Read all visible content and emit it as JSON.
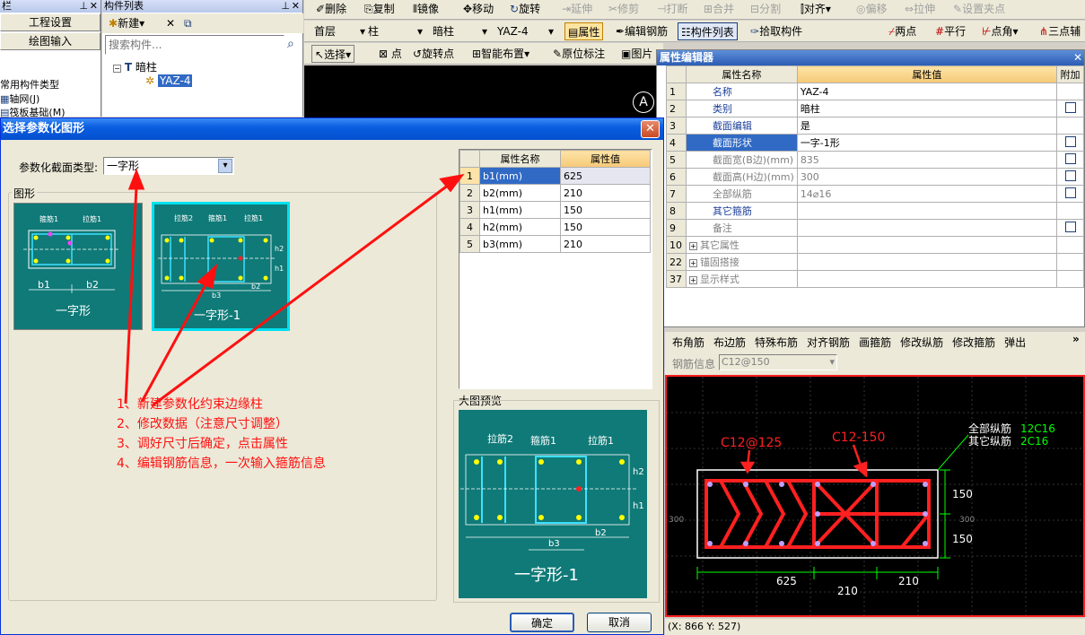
{
  "left_panel": {
    "title": "栏",
    "btn_project": "工程设置",
    "btn_drawing": "绘图输入",
    "tree_root": "常用构件类型",
    "tree_items": [
      "轴网(J)",
      "筏板基础(M)"
    ]
  },
  "comp_list": {
    "title": "构件列表",
    "new_label": "新建",
    "search_placeholder": "搜索构件...",
    "root": "暗柱",
    "child": "YAZ-4"
  },
  "toolbar1": {
    "delete": "删除",
    "copy": "复制",
    "mirror": "镜像",
    "move": "移动",
    "rotate": "旋转",
    "extend": "延伸",
    "trim": "修剪",
    "break": "打断",
    "merge": "合并",
    "split": "分割",
    "align": "对齐",
    "offset": "偏移",
    "stretch": "拉伸",
    "set_point": "设置夹点"
  },
  "toolbar2": {
    "floor": "首层",
    "type": "柱",
    "subtype": "暗柱",
    "comp": "YAZ-4",
    "props": "属性",
    "edit_rebar": "编辑钢筋",
    "comp_list": "构件列表",
    "pick": "拾取构件",
    "two_pt": "两点",
    "parallel": "平行",
    "pt_angle": "点角",
    "three_pt": "三点辅"
  },
  "toolbar3": {
    "select": "选择",
    "point": "点",
    "rotate_pt": "旋转点",
    "smart": "智能布置",
    "origin": "原位标注",
    "img": "图片"
  },
  "axis_label": "A",
  "prop_editor": {
    "title": "属性编辑器",
    "col_name": "属性名称",
    "col_value": "属性值",
    "col_extra": "附加",
    "rows": [
      {
        "n": "1",
        "name": "名称",
        "value": "YAZ-4",
        "blue": true,
        "chk": false
      },
      {
        "n": "2",
        "name": "类别",
        "value": "暗柱",
        "blue": true,
        "chk": true
      },
      {
        "n": "3",
        "name": "截面编辑",
        "value": "是",
        "blue": true,
        "chk": false
      },
      {
        "n": "4",
        "name": "截面形状",
        "value": "一字-1形",
        "blue": true,
        "chk": true,
        "sel": true
      },
      {
        "n": "5",
        "name": "截面宽(B边)(mm)",
        "value": "835",
        "blue": false,
        "chk": true
      },
      {
        "n": "6",
        "name": "截面高(H边)(mm)",
        "value": "300",
        "blue": false,
        "chk": true
      },
      {
        "n": "7",
        "name": "全部纵筋",
        "value": "14⌀16",
        "blue": false,
        "chk": true
      },
      {
        "n": "8",
        "name": "其它箍筋",
        "value": "",
        "blue": true,
        "chk": false
      },
      {
        "n": "9",
        "name": "备注",
        "value": "",
        "blue": false,
        "chk": true
      },
      {
        "n": "10",
        "name": "其它属性",
        "value": "",
        "blue": false,
        "chk": false,
        "plus": true
      },
      {
        "n": "22",
        "name": "锚固搭接",
        "value": "",
        "blue": false,
        "chk": false,
        "plus": true
      },
      {
        "n": "37",
        "name": "显示样式",
        "value": "",
        "blue": false,
        "chk": false,
        "plus": true
      }
    ]
  },
  "rebar_toolbar": {
    "items": [
      "布角筋",
      "布边筋",
      "特殊布筋",
      "对齐钢筋",
      "画箍筋",
      "修改纵筋",
      "修改箍筋",
      "弹出"
    ],
    "info_label": "钢筋信息",
    "info_value": "C12@150"
  },
  "section_view": {
    "label_c12_125": "C12@125",
    "label_c12_150": "C12-150",
    "all_long": "全部纵筋",
    "all_long_val": "12C16",
    "other_long": "其它纵筋",
    "other_long_val": "2C16",
    "dim_h1": "150",
    "dim_h2": "150",
    "dim_b1": "625",
    "dim_b2": "210",
    "dim_b3": "210",
    "left_dim": "300",
    "right_dim": "300"
  },
  "status_bar": "(X: 866 Y: 527)",
  "dialog": {
    "title": "选择参数化图形",
    "type_label": "参数化截面类型:",
    "type_value": "一字形",
    "group_shape": "图形",
    "shape1_name": "一字形",
    "shape2_name": "一字形-1",
    "labels": {
      "gujin": "箍筋1",
      "lajin": "拉筋1",
      "lajin2": "拉筋2",
      "b1": "b1",
      "b2": "b2",
      "b3": "b3",
      "h1": "h1",
      "h2": "h2"
    },
    "param_table": {
      "col_name": "属性名称",
      "col_value": "属性值",
      "rows": [
        {
          "n": "1",
          "name": "b1(mm)",
          "value": "625"
        },
        {
          "n": "2",
          "name": "b2(mm)",
          "value": "210"
        },
        {
          "n": "3",
          "name": "h1(mm)",
          "value": "150"
        },
        {
          "n": "4",
          "name": "h2(mm)",
          "value": "150"
        },
        {
          "n": "5",
          "name": "b3(mm)",
          "value": "210"
        }
      ]
    },
    "preview_title": "大图预览",
    "preview_name": "一字形-1",
    "ok": "确定",
    "cancel": "取消"
  },
  "annotations": [
    "1、新建参数化约束边缘柱",
    "2、修改数据（注意尺寸调整）",
    "3、调好尺寸后确定，点击属性",
    "4、编辑钢筋信息，一次输入箍筋信息"
  ]
}
